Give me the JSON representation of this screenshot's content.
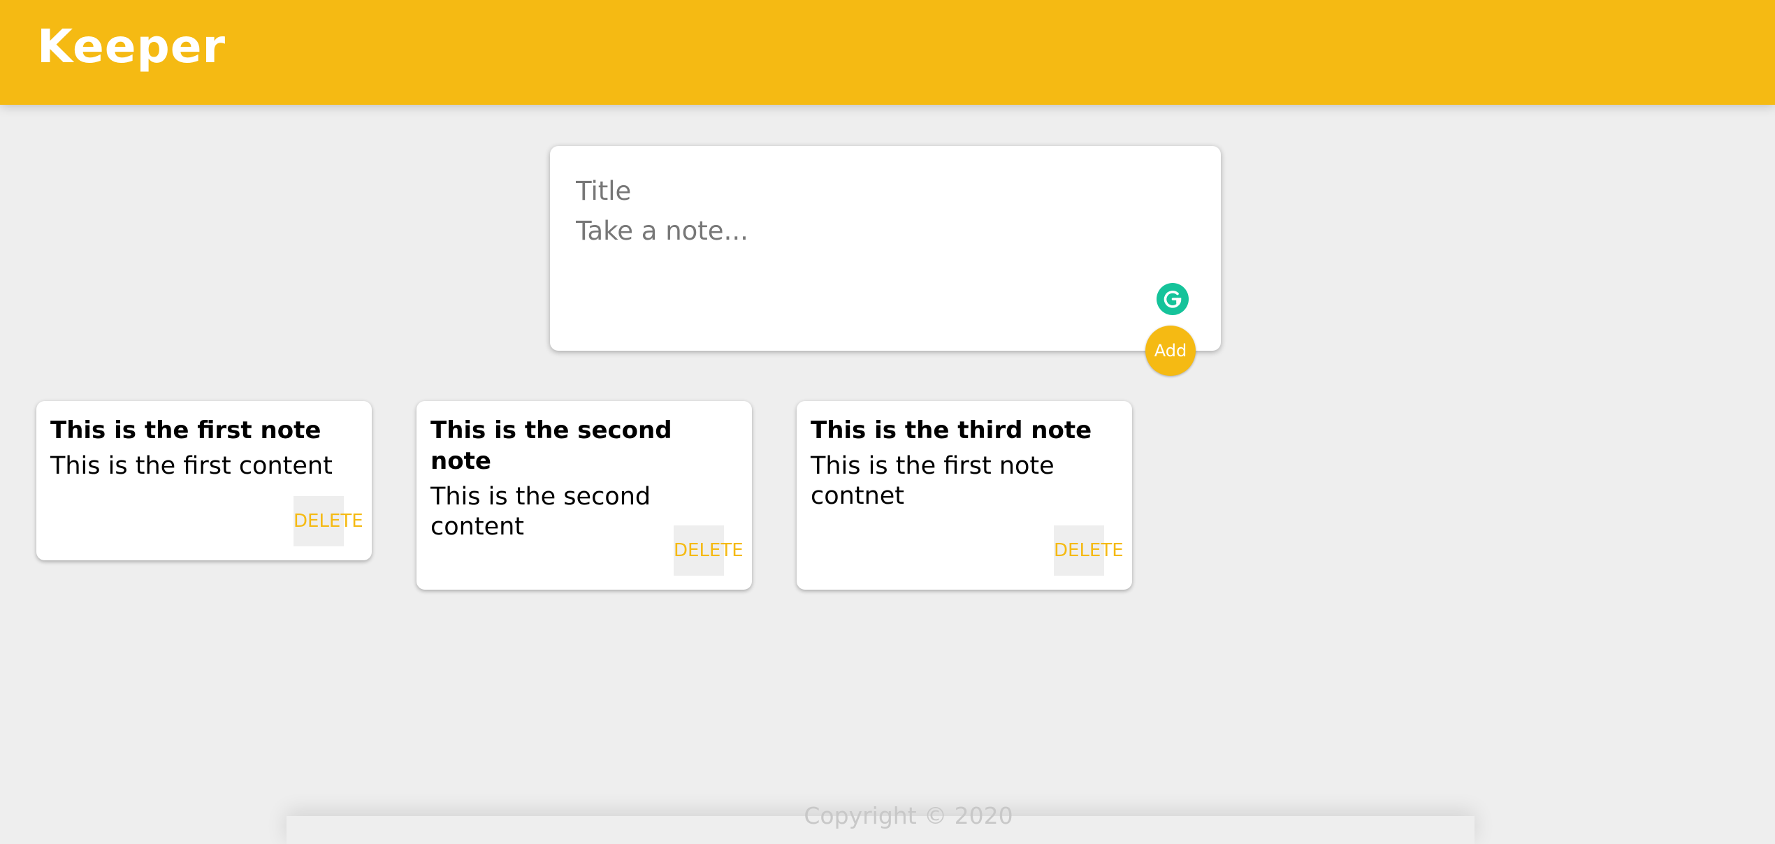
{
  "header": {
    "title": "Keeper"
  },
  "create_note": {
    "title_placeholder": "Title",
    "content_placeholder": "Take a note...",
    "add_label": "Add",
    "grammarly_icon": "grammarly-g-icon"
  },
  "notes": [
    {
      "title": "This is the first note",
      "content": "This is the first content",
      "delete_label": "DELETE"
    },
    {
      "title": "This is the second note",
      "content": "This is the second content",
      "delete_label": "DELETE"
    },
    {
      "title": "This is the third note",
      "content": "This is the first note contnet",
      "delete_label": "DELETE"
    }
  ],
  "footer": {
    "text": "Copyright © 2020"
  },
  "colors": {
    "accent": "#f5ba13",
    "background": "#eeeeee",
    "grammarly": "#15c39a"
  }
}
